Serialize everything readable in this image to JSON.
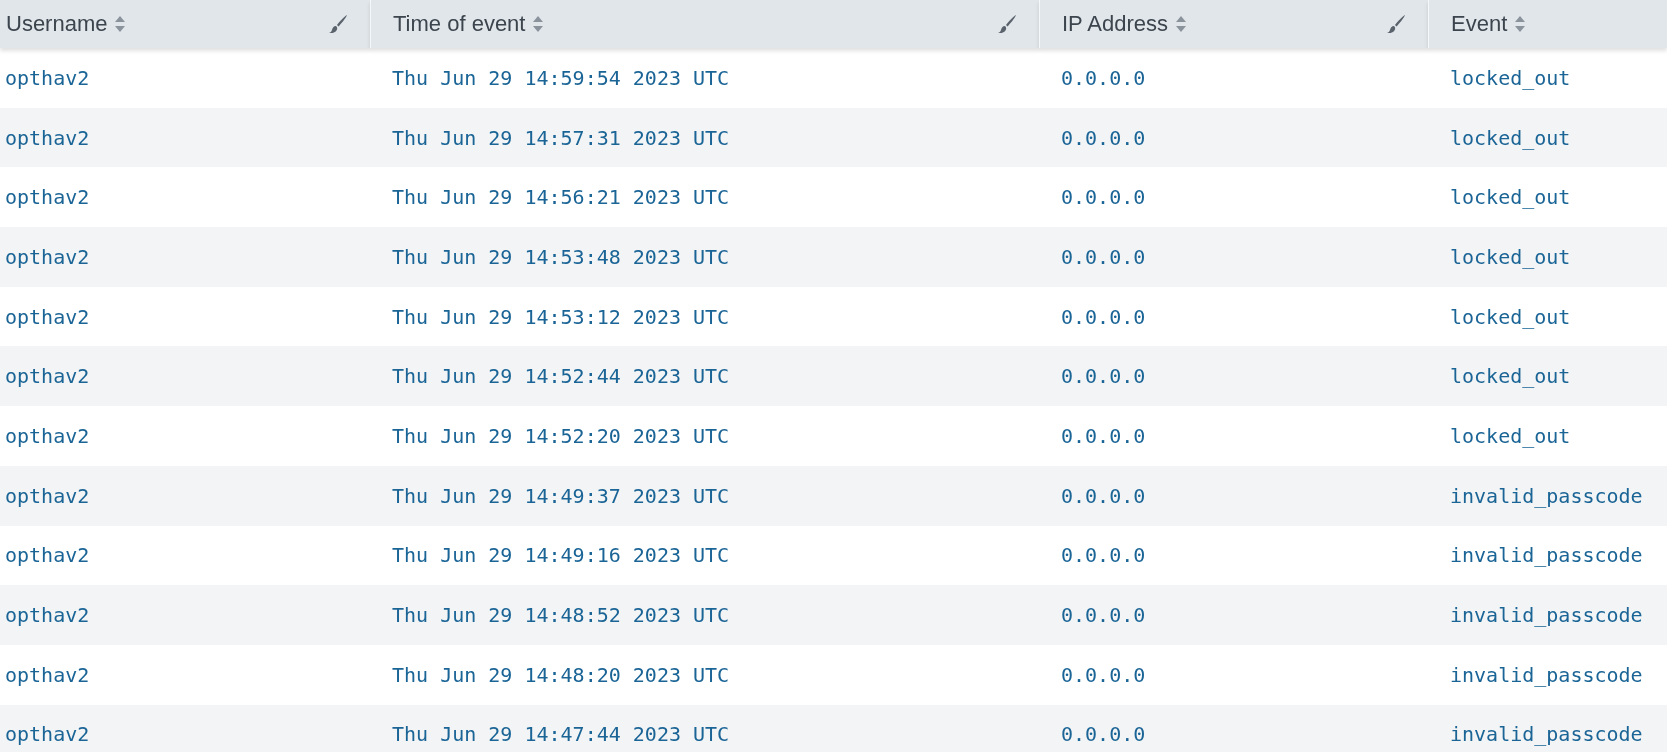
{
  "table": {
    "columns": [
      {
        "label": "Username",
        "formattable": true
      },
      {
        "label": "Time of event",
        "formattable": true
      },
      {
        "label": "IP Address",
        "formattable": true
      },
      {
        "label": "Event",
        "formattable": false
      }
    ],
    "rows": [
      [
        "opthav2",
        "Thu Jun 29 14:59:54 2023 UTC",
        "0.0.0.0",
        "locked_out"
      ],
      [
        "opthav2",
        "Thu Jun 29 14:57:31 2023 UTC",
        "0.0.0.0",
        "locked_out"
      ],
      [
        "opthav2",
        "Thu Jun 29 14:56:21 2023 UTC",
        "0.0.0.0",
        "locked_out"
      ],
      [
        "opthav2",
        "Thu Jun 29 14:53:48 2023 UTC",
        "0.0.0.0",
        "locked_out"
      ],
      [
        "opthav2",
        "Thu Jun 29 14:53:12 2023 UTC",
        "0.0.0.0",
        "locked_out"
      ],
      [
        "opthav2",
        "Thu Jun 29 14:52:44 2023 UTC",
        "0.0.0.0",
        "locked_out"
      ],
      [
        "opthav2",
        "Thu Jun 29 14:52:20 2023 UTC",
        "0.0.0.0",
        "locked_out"
      ],
      [
        "opthav2",
        "Thu Jun 29 14:49:37 2023 UTC",
        "0.0.0.0",
        "invalid_passcode"
      ],
      [
        "opthav2",
        "Thu Jun 29 14:49:16 2023 UTC",
        "0.0.0.0",
        "invalid_passcode"
      ],
      [
        "opthav2",
        "Thu Jun 29 14:48:52 2023 UTC",
        "0.0.0.0",
        "invalid_passcode"
      ],
      [
        "opthav2",
        "Thu Jun 29 14:48:20 2023 UTC",
        "0.0.0.0",
        "invalid_passcode"
      ],
      [
        "opthav2",
        "Thu Jun 29 14:47:44 2023 UTC",
        "0.0.0.0",
        "invalid_passcode"
      ]
    ]
  }
}
